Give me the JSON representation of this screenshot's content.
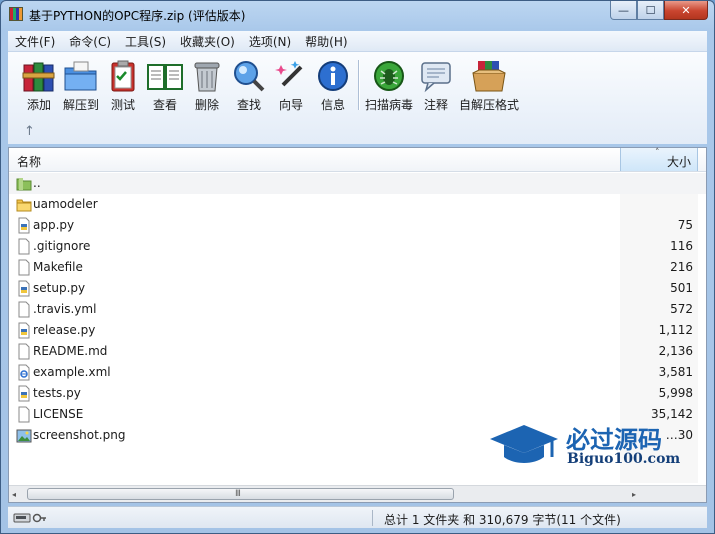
{
  "window": {
    "title": "基于PYTHON的OPC程序.zip (评估版本)",
    "controls": {
      "minimize": "—",
      "maximize": "☐",
      "close": "✕"
    }
  },
  "menu": [
    "文件(F)",
    "命令(C)",
    "工具(S)",
    "收藏夹(O)",
    "选项(N)",
    "帮助(H)"
  ],
  "toolbar": {
    "buttons": [
      {
        "label": "添加",
        "icon": "archive-books-icon"
      },
      {
        "label": "解压到",
        "icon": "folder-extract-icon"
      },
      {
        "label": "测试",
        "icon": "clipboard-check-icon"
      },
      {
        "label": "查看",
        "icon": "open-book-icon"
      },
      {
        "label": "删除",
        "icon": "trash-can-icon"
      },
      {
        "label": "查找",
        "icon": "magnifier-icon"
      },
      {
        "label": "向导",
        "icon": "magic-wand-icon"
      },
      {
        "label": "信息",
        "icon": "info-icon"
      },
      {
        "label": "扫描病毒",
        "icon": "virus-scan-icon"
      },
      {
        "label": "注释",
        "icon": "comment-icon"
      },
      {
        "label": "自解压格式",
        "icon": "sfx-box-icon"
      }
    ],
    "up_glyph": "↑"
  },
  "columns": {
    "name": "名称",
    "size": "大小",
    "sort_glyph": "˄"
  },
  "files": [
    {
      "name": "..",
      "size": "",
      "type": "parent-folder"
    },
    {
      "name": "uamodeler",
      "size": "",
      "type": "folder"
    },
    {
      "name": "app.py",
      "size": "75",
      "type": "python"
    },
    {
      "name": ".gitignore",
      "size": "116",
      "type": "blank"
    },
    {
      "name": "Makefile",
      "size": "216",
      "type": "blank"
    },
    {
      "name": "setup.py",
      "size": "501",
      "type": "python"
    },
    {
      "name": ".travis.yml",
      "size": "572",
      "type": "blank"
    },
    {
      "name": "release.py",
      "size": "1,112",
      "type": "python"
    },
    {
      "name": "README.md",
      "size": "2,136",
      "type": "blank"
    },
    {
      "name": "example.xml",
      "size": "3,581",
      "type": "xml"
    },
    {
      "name": "tests.py",
      "size": "5,998",
      "type": "python"
    },
    {
      "name": "LICENSE",
      "size": "35,142",
      "type": "blank"
    },
    {
      "name": "screenshot.png",
      "size": "…30",
      "type": "image"
    }
  ],
  "scrollbar": {
    "grip": "III",
    "left_arrow": "◂",
    "right_arrow": "▸"
  },
  "status": {
    "text": "总计 1 文件夹 和 310,679 字节(11 个文件)"
  },
  "watermark": {
    "cn": "必过源码",
    "en": "Biguo100.com"
  },
  "colors": {
    "accent": "#3a7bd5",
    "folder": "#f3c44b",
    "title_bg": "#bcd6f1"
  }
}
